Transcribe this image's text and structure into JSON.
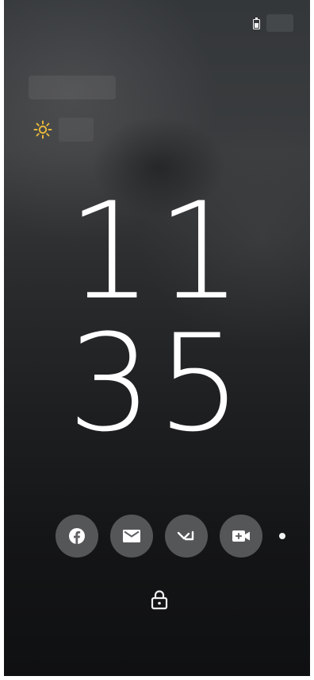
{
  "status_bar": {
    "battery_icon": "battery-icon",
    "battery_level_fraction": 0.6
  },
  "weather": {
    "icon": "sun-icon",
    "icon_color": "#e8b83a"
  },
  "clock": {
    "hours": "11",
    "minutes": "35"
  },
  "shortcuts": [
    {
      "icon": "facebook-icon"
    },
    {
      "icon": "mail-icon"
    },
    {
      "icon": "missed-call-icon"
    },
    {
      "icon": "video-call-icon"
    }
  ],
  "lock": {
    "icon": "lock-icon"
  },
  "colors": {
    "text": "#ffffff",
    "shortcut_bg": "#5f6164"
  }
}
